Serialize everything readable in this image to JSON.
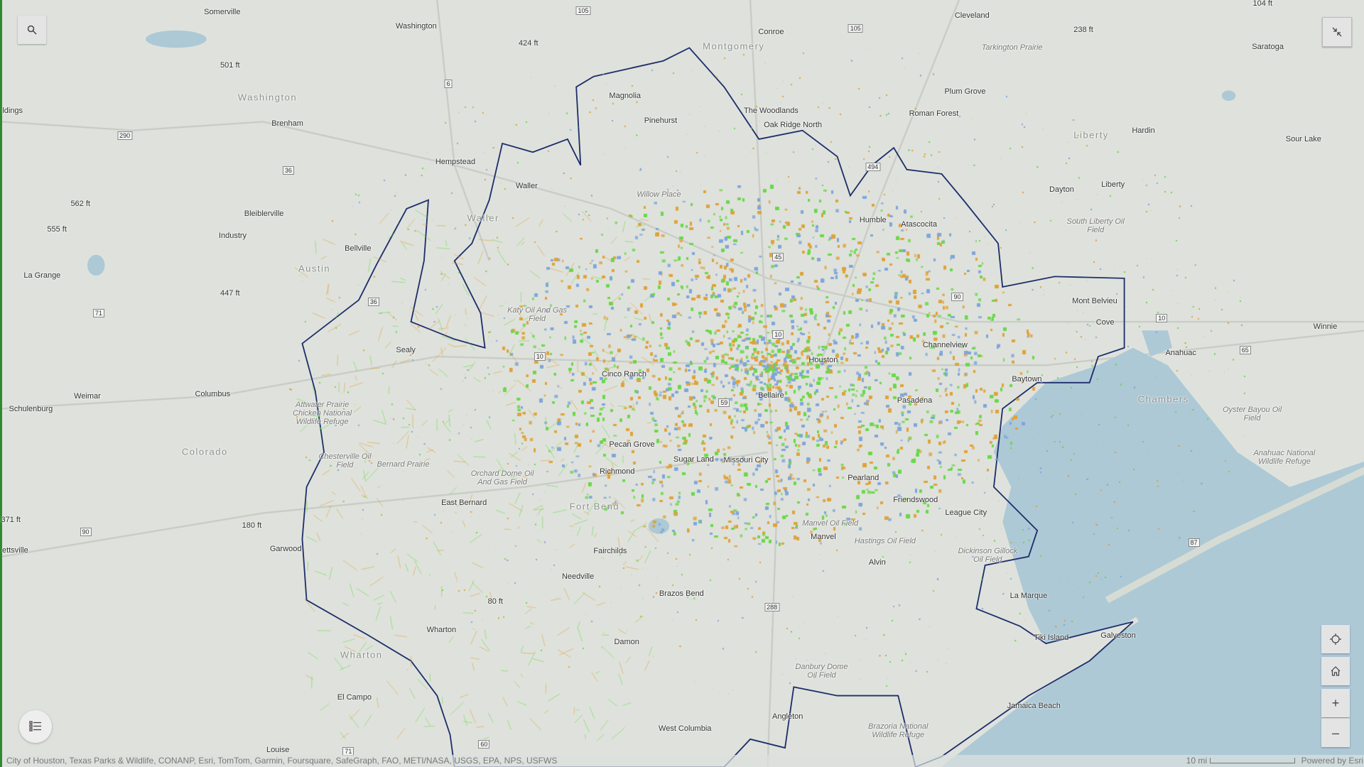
{
  "map": {
    "colors": {
      "land": "#dfe2dc",
      "water": "#adc9d6",
      "boundary": "#1f2f6b",
      "orange": "#e0a23a",
      "blue": "#7fa6dc",
      "green": "#6ad84a"
    },
    "labels": [
      "Somerville",
      "Washington",
      "Conroe",
      "Cleveland",
      "Montgomery",
      "Magnolia",
      "Pinehurst",
      "The Woodlands",
      "Oak Ridge North",
      "Plum Grove",
      "Roman Forest",
      "Tarkington Prairie",
      "Saratoga",
      "Washington",
      "Brenham",
      "Hempstead",
      "Waller",
      "Liberty",
      "Hardin",
      "Sour Lake",
      "Dayton",
      "Liberty",
      "Bleiblerville",
      "Industry",
      "Bellville",
      "Humble",
      "Atascocita",
      "Austin",
      "La Grange",
      "South Liberty Oil Field",
      "Mont Belvieu",
      "Cove",
      "Winnie",
      "Anahuac",
      "Katy Oil And Gas Field",
      "Sealy",
      "Channelview",
      "Houston",
      "Cinco Ranch",
      "Baytown",
      "Weimar",
      "Columbus",
      "Schulenburg",
      "Attwater Prairie Chicken National Wildlife Refuge",
      "Bellaire",
      "Pasadena",
      "Chambers",
      "Oyster Bayou Oil Field",
      "Colorado",
      "Pecan Grove",
      "Sugar Land",
      "Missouri City",
      "Chesterville Oil Field",
      "Bernard Prairie",
      "Orchard Dome Oil And Gas Field",
      "Richmond",
      "Pearland",
      "Anahuac National Wildlife Refuge",
      "East Bernard",
      "Friendswood",
      "League City",
      "Fort Bend",
      "Manvel Oil Field",
      "Manvel",
      "Hastings Oil Field",
      "Dickinson Gillock Oil Field",
      "Garwood",
      "Fairchilds",
      "Alvin",
      "Needville",
      "Brazos Bend",
      "La Marque",
      "Wharton",
      "Tiki Island",
      "Galveston",
      "Damon",
      "Wharton",
      "Danbury Dome Oil Field",
      "El Campo",
      "Jamaica Beach",
      "Angleton",
      "West Columbia",
      "Brazoria National Wildlife Refuge",
      "Louise",
      "Waller",
      "Willow Place",
      "ettsville",
      "ldings",
      "424 ft",
      "501 ft",
      "562 ft",
      "555 ft",
      "447 ft",
      "238 ft",
      "104 ft",
      "180 ft",
      "371 ft",
      "80 ft"
    ],
    "highway_shields": [
      "105",
      "105",
      "6",
      "290",
      "36",
      "36",
      "71",
      "90",
      "10",
      "10",
      "45",
      "59",
      "90",
      "288",
      "87",
      "60",
      "71",
      "494",
      "65",
      "10"
    ]
  },
  "controls": {
    "search_icon": "search-icon",
    "collapse_icon": "collapse-icon",
    "locate_icon": "locate-icon",
    "home_icon": "home-icon",
    "zoom_in": "+",
    "zoom_out": "–",
    "legend_icon": "legend-list-icon"
  },
  "footer": {
    "attribution": "City of Houston, Texas Parks & Wildlife, CONANP, Esri, TomTom, Garmin, Foursquare, SafeGraph, FAO, METI/NASA, USGS, EPA, NPS, USFWS",
    "scale_label": "10 mi",
    "powered_by": "Powered by Esri"
  }
}
